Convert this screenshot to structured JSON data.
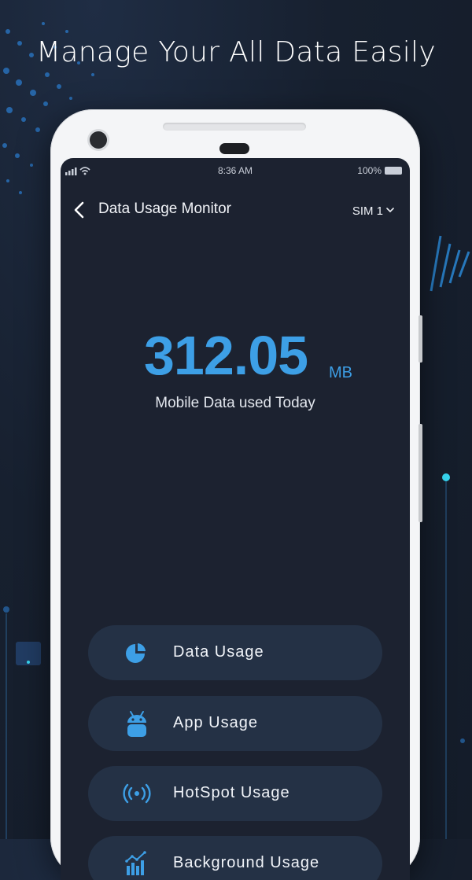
{
  "headline": "Manage Your All Data Easily",
  "status_bar": {
    "time": "8:36 AM",
    "battery": "100%"
  },
  "header": {
    "title": "Data Usage Monitor",
    "sim_label": "SIM 1"
  },
  "usage": {
    "value": "312.05",
    "unit": "MB",
    "caption": "Mobile Data used Today"
  },
  "menu": [
    {
      "label": "Data Usage",
      "icon": "pie-chart-icon"
    },
    {
      "label": "App Usage",
      "icon": "android-icon"
    },
    {
      "label": "HotSpot Usage",
      "icon": "hotspot-icon"
    },
    {
      "label": "Background Usage",
      "icon": "bar-chart-icon"
    }
  ],
  "colors": {
    "accent": "#3d9fe6",
    "screen_bg": "#1c2230",
    "button_bg": "#243145",
    "page_bg": "#17202f"
  }
}
